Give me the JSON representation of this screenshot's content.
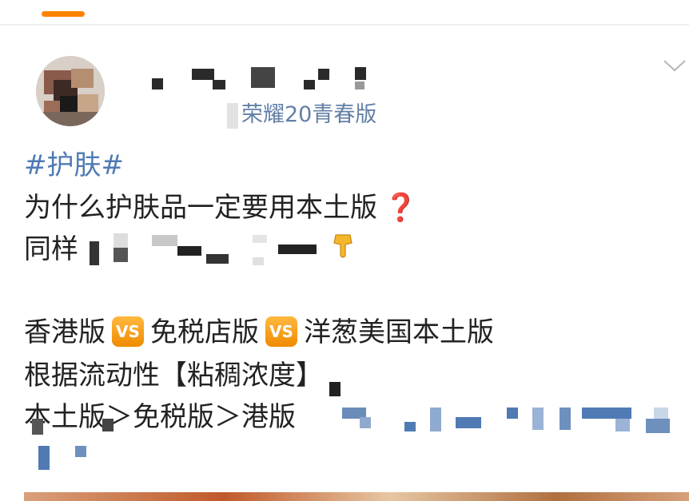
{
  "header": {
    "tab_indicator_color": "#ff8200"
  },
  "post": {
    "device": "荣耀20青春版",
    "hashtag": "#护肤#",
    "lines": {
      "line1": "为什么护肤品一定要用本土版",
      "line1_emoji": "❓",
      "line2_prefix": "同样",
      "line3_a": "香港版",
      "line3_b": "免税店版",
      "line3_c": "洋葱美国本土版",
      "vs_label": "VS",
      "line4": "根据流动性【粘稠浓度】",
      "line5": "本土版＞免税版＞港版"
    },
    "link_color": "#4f7ab4",
    "device_color": "#627fa6"
  },
  "icons": {
    "expand": "chevron-down-icon",
    "point": "pointing-down-hand-icon"
  }
}
